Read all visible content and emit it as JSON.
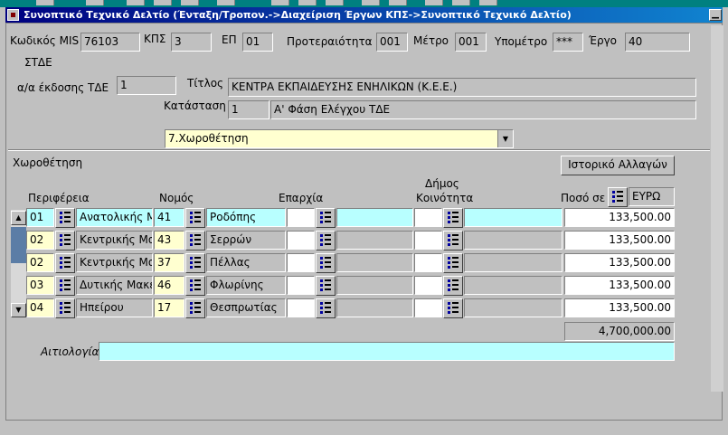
{
  "window": {
    "title": "Συνοπτικό Τεχνικό Δελτίο (Ένταξη/Τροπον.->Διαχείριση Έργων ΚΠΣ->Συνοπτικό Τεχνικό Δελτίο)"
  },
  "header": {
    "mis_label": "Κωδικός MIS",
    "mis_value": "76103",
    "kps_label": "ΚΠΣ",
    "kps_value": "3",
    "ep_label": "ΕΠ",
    "ep_value": "01",
    "priority_label": "Προτεραιότητα",
    "priority_value": "001",
    "metro_label": "Μέτρο",
    "metro_value": "001",
    "submetro_label": "Υπομέτρο",
    "submetro_value": "***",
    "ergo_label": "Έργο",
    "ergo_value": "40"
  },
  "tde": {
    "section_label": "ΣΤΔΕ",
    "issue_label": "α/α έκδοσης ΤΔΕ",
    "issue_value": "1",
    "title_label": "Τίτλος",
    "title_value": "ΚΕΝΤΡΑ ΕΚΠΑΙΔΕΥΣΗΣ ΕΝΗΛΙΚΩΝ (Κ.Ε.Ε.)",
    "status_label": "Κατάσταση",
    "status_code": "1",
    "status_text": "Α' Φάση Ελέγχου ΤΔΕ"
  },
  "tab_select": {
    "value": "7.Χωροθέτηση"
  },
  "location": {
    "section_label": "Χωροθέτηση",
    "history_button": "Ιστορικό Αλλαγών",
    "col_region": "Περιφέρεια",
    "col_prefecture": "Νομός",
    "col_province": "Επαρχία",
    "col_municipality_1": "Δήμος",
    "col_municipality_2": "Κοινότητα",
    "col_amount": "Ποσό σε",
    "currency": "ΕΥΡΩ",
    "rows": [
      {
        "region_code": "01",
        "region_name": "Ανατολικής Μ",
        "pref_code": "41",
        "pref_name": "Ροδόπης",
        "amount": "133,500.00"
      },
      {
        "region_code": "02",
        "region_name": "Κεντρικής Μα",
        "pref_code": "43",
        "pref_name": "Σερρών",
        "amount": "133,500.00"
      },
      {
        "region_code": "02",
        "region_name": "Κεντρικής Μα",
        "pref_code": "37",
        "pref_name": "Πέλλας",
        "amount": "133,500.00"
      },
      {
        "region_code": "03",
        "region_name": "Δυτικής Μακε",
        "pref_code": "46",
        "pref_name": "Φλωρίνης",
        "amount": "133,500.00"
      },
      {
        "region_code": "04",
        "region_name": "Ηπείρου",
        "pref_code": "17",
        "pref_name": "Θεσπρωτίας",
        "amount": "133,500.00"
      }
    ],
    "total": "4,700,000.00",
    "justification_label": "Αιτιολογία",
    "justification_value": ""
  },
  "colors": {
    "title_start": "#000080",
    "current_row": "#b8ffff",
    "dropdown_bg": "#ffffd0"
  }
}
